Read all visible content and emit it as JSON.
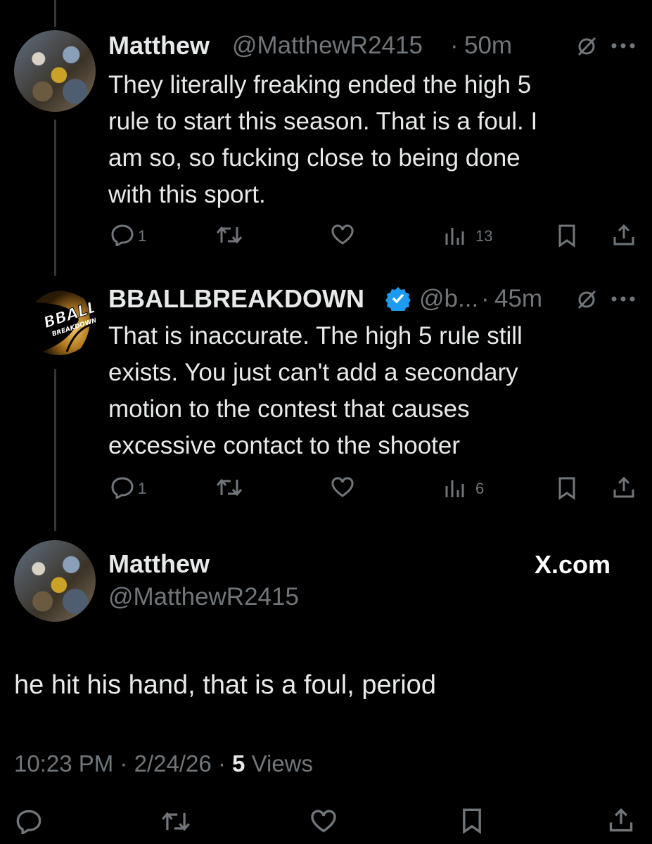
{
  "tweets": [
    {
      "name": "Matthew",
      "handle": "@MatthewR2415",
      "time": "50m",
      "text": "They literally freaking ended the high 5 rule to start this season. That is a foul. I am so, so fucking close to being done with this sport.",
      "lines": [
        "They literally freaking ended the high 5",
        "rule to start this season. That is a foul. I",
        "am so, so fucking close to being done",
        "with this sport."
      ],
      "replies": "1",
      "views": "13"
    },
    {
      "name": "BBALLBREAKDOWN",
      "handle": "@b...",
      "time": "45m",
      "verified": true,
      "avatar_text": [
        "BBALL",
        "BREAKDOWN"
      ],
      "text": "That is inaccurate. The high 5 rule still exists. You just can't add a secondary motion to the contest that causes excessive contact to the shooter",
      "lines": [
        "That is inaccurate. The high 5 rule still",
        "exists. You just can't add a secondary",
        "motion to the contest that causes",
        "excessive contact to the shooter"
      ],
      "replies": "1",
      "views": "6"
    }
  ],
  "main": {
    "name": "Matthew",
    "handle": "@MatthewR2415",
    "brand": "X.com",
    "text": "he hit his hand, that is a foul, period",
    "meta_time": "10:23 PM",
    "meta_date": "2/24/26",
    "views_count": "5",
    "views_label": "Views"
  },
  "separator": "·",
  "colors": {
    "background": "#000000",
    "text": "#e7e9ea",
    "muted": "#71767b",
    "verified": "#1d9bf0",
    "line": "#333639"
  },
  "icons": [
    "reply-icon",
    "retweet-icon",
    "like-icon",
    "views-icon",
    "bookmark-icon",
    "share-icon",
    "grok-icon",
    "more-icon",
    "verified-icon"
  ]
}
